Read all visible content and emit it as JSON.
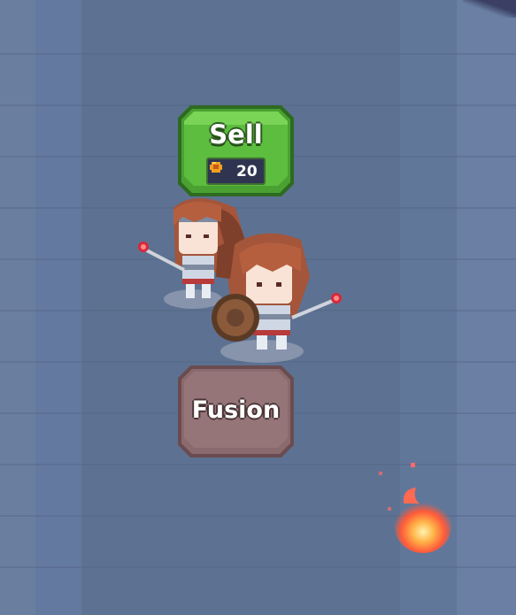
{
  "scene": "dungeon-floor",
  "actions": {
    "sell_label": "Sell",
    "sell_price": "20",
    "sell_currency_icon": "coin-icon",
    "fusion_label": "Fusion"
  },
  "units": [
    {
      "name": "knight-unit-1",
      "icon": "shield-knight-sprite"
    },
    {
      "name": "knight-unit-2",
      "icon": "shield-knight-sprite"
    }
  ],
  "colors": {
    "floor": "#5f7493",
    "sell_button": "#56b53a",
    "fusion_button": "#8a6a6c",
    "flame": "#ff7a3a"
  }
}
